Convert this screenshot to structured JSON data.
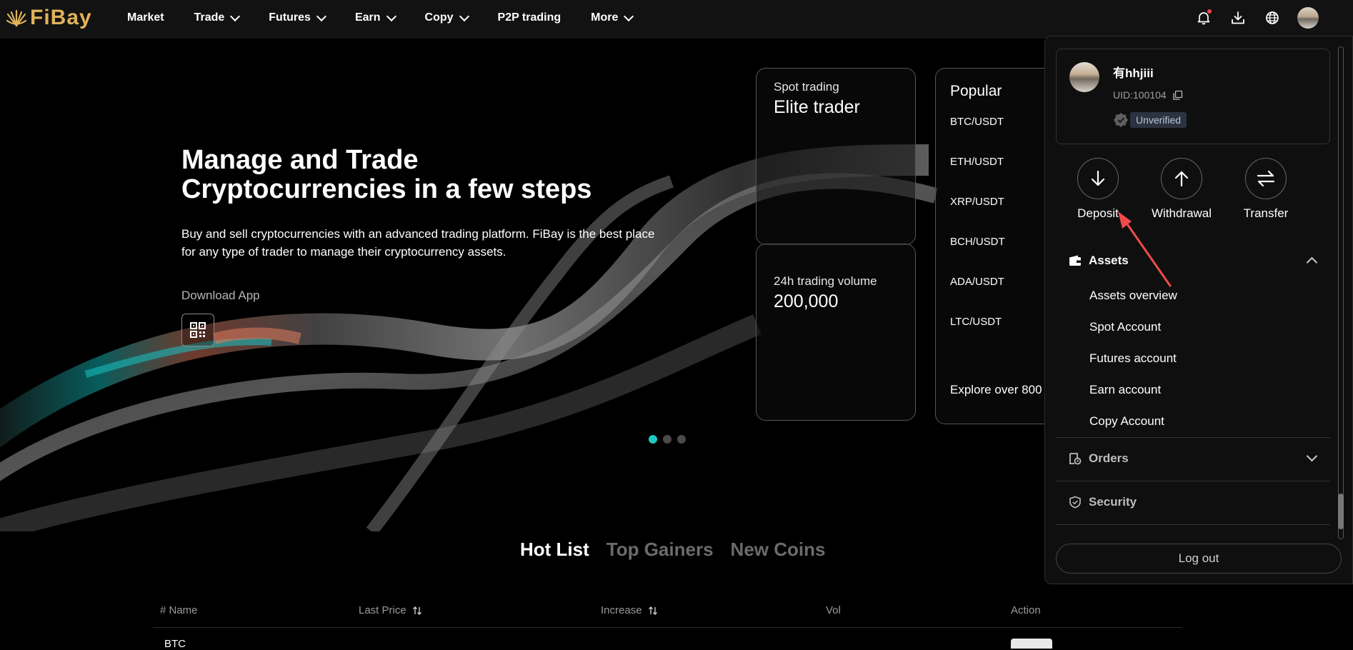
{
  "brand": {
    "name": "FiBay",
    "color": "#e0b25a"
  },
  "nav": {
    "items": [
      {
        "label": "Market",
        "has_dropdown": false
      },
      {
        "label": "Trade",
        "has_dropdown": true
      },
      {
        "label": "Futures",
        "has_dropdown": true
      },
      {
        "label": "Earn",
        "has_dropdown": true
      },
      {
        "label": "Copy",
        "has_dropdown": true
      },
      {
        "label": "P2P trading",
        "has_dropdown": false
      },
      {
        "label": "More",
        "has_dropdown": true
      }
    ],
    "icons": [
      "bell-icon",
      "download-icon",
      "globe-icon",
      "avatar"
    ]
  },
  "hero": {
    "title_line1": "Manage and Trade",
    "title_line2": "Cryptocurrencies in a few steps",
    "subtitle_line1": "Buy and sell cryptocurrencies with an advanced trading platform. FiBay is the best place",
    "subtitle_line2": "for any type of trader to manage their cryptocurrency assets.",
    "download_label": "Download App",
    "cards": {
      "spot_small": "Spot trading",
      "spot_big": "Elite trader",
      "volume_small": "24h trading volume",
      "volume_big": "200,000",
      "popular_title": "Popular",
      "pairs": [
        "BTC/USDT",
        "ETH/USDT",
        "XRP/USDT",
        "BCH/USDT",
        "ADA/USDT",
        "LTC/USDT"
      ],
      "explore": "Explore over 800"
    },
    "carousel": {
      "count": 3,
      "active_index": 0,
      "accent": "#1fc8c0"
    }
  },
  "list": {
    "tabs": [
      {
        "label": "Hot List",
        "active": true
      },
      {
        "label": "Top Gainers",
        "active": false
      },
      {
        "label": "New Coins",
        "active": false
      }
    ],
    "columns": [
      "# Name",
      "Last Price",
      "Increase",
      "Vol",
      "Action"
    ],
    "first_row_name": "BTC"
  },
  "account_menu": {
    "username": "有hhjiii",
    "uid": "UID:100104",
    "verification": "Unverified",
    "actions": [
      {
        "label": "Deposit",
        "icon": "arrow-down-icon"
      },
      {
        "label": "Withdrawal",
        "icon": "arrow-up-icon"
      },
      {
        "label": "Transfer",
        "icon": "transfer-icon"
      }
    ],
    "assets": {
      "label": "Assets",
      "expanded": true,
      "items": [
        "Assets overview",
        "Spot Account",
        "Futures account",
        "Earn account",
        "Copy Account"
      ]
    },
    "orders": {
      "label": "Orders",
      "expanded": false
    },
    "security": {
      "label": "Security"
    },
    "logout": "Log out"
  },
  "annotation": {
    "color": "#ef4b4b",
    "target": "Deposit"
  }
}
